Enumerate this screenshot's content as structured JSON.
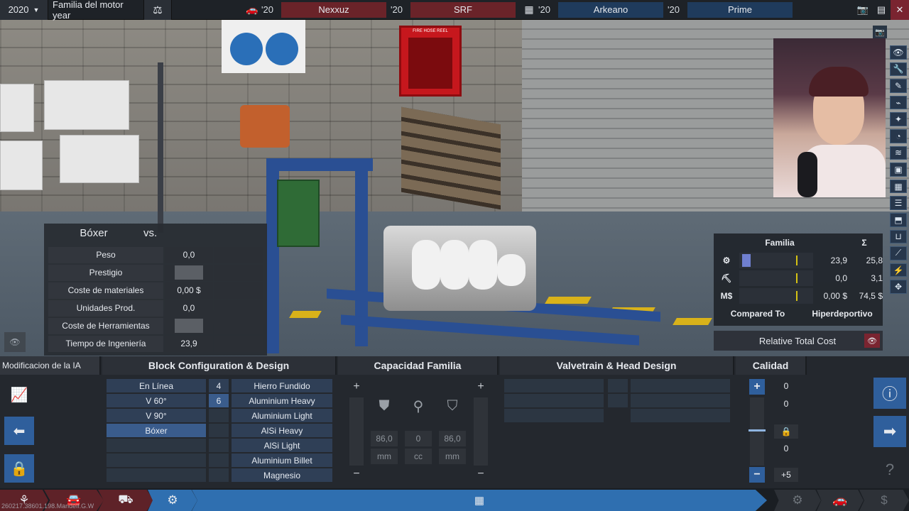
{
  "topbar": {
    "year": "2020",
    "family_label": "Familia del motor year",
    "competitors": [
      {
        "year": "'20",
        "name": "Nexxuz",
        "color": "#6a2329"
      },
      {
        "year": "'20",
        "name": "SRF",
        "color": "#6a2329"
      },
      {
        "year": "'20",
        "name": "Arkeano",
        "color": "#1f3b5c"
      },
      {
        "year": "'20",
        "name": "Prime",
        "color": "#1f3b5c"
      }
    ],
    "icons": [
      "car-icon",
      "engine-icon",
      "camera-icon",
      "save-icon",
      "close-icon"
    ]
  },
  "scene": {
    "hose_box_label": "FIRE HOSE REEL"
  },
  "comparison": {
    "title": "Bóxer",
    "vs": "vs.",
    "rows": [
      {
        "label": "Peso",
        "value": "0,0"
      },
      {
        "label": "Prestigio",
        "value": ""
      },
      {
        "label": "Coste de materiales",
        "value": "0,00 $"
      },
      {
        "label": "Unidades Prod.",
        "value": "0,0"
      },
      {
        "label": "Coste de Herramientas",
        "value": ""
      },
      {
        "label": "Tiempo de Ingeniería",
        "value": "23,9"
      }
    ]
  },
  "family_stats": {
    "col_family": "Familia",
    "col_sum": "Σ",
    "rows": [
      {
        "icon": "engine-gear-icon",
        "icon_text": "⚙",
        "fill": 0.12,
        "value": "23,9",
        "sum": "25,8"
      },
      {
        "icon": "tool-icon",
        "icon_text": "⛏",
        "fill": 0,
        "value": "0,0",
        "sum": "3,1"
      },
      {
        "icon": "money-icon",
        "icon_text": "M$",
        "fill": 0,
        "value": "0,00 $",
        "sum": "74,5 $"
      }
    ],
    "compared_to_label": "Compared To",
    "compared_to_value": "Hiperdeportivo",
    "relative_cost_label": "Relative Total Cost",
    "accent": "#6f7fcf"
  },
  "editor": {
    "ai_tab": "Modificacion de la IA",
    "sections": {
      "block": "Block Configuration & Design",
      "capacity": "Capacidad Familia",
      "valvetrain": "Valvetrain & Head Design",
      "quality": "Calidad"
    },
    "layouts": [
      "En Línea",
      "V 60°",
      "V 90°",
      "Bóxer"
    ],
    "selected_layout": "Bóxer",
    "cylinders": [
      "4",
      "6"
    ],
    "selected_cylinders": "6",
    "materials": [
      "Hierro Fundido",
      "Aluminium Heavy",
      "Aluminium Light",
      "AlSi Heavy",
      "AlSi Light",
      "Aluminium Billet",
      "Magnesio"
    ],
    "capacity": {
      "bore": "86,0",
      "displacement": "0",
      "stroke": "86,0",
      "bore_unit": "mm",
      "disp_unit": "cc",
      "stroke_unit": "mm"
    },
    "quality": {
      "values": [
        "0",
        "0",
        "0"
      ],
      "bonus": "+5"
    }
  },
  "nav": {
    "build_info": "260217.38601.198.Mandelf.G.W"
  }
}
